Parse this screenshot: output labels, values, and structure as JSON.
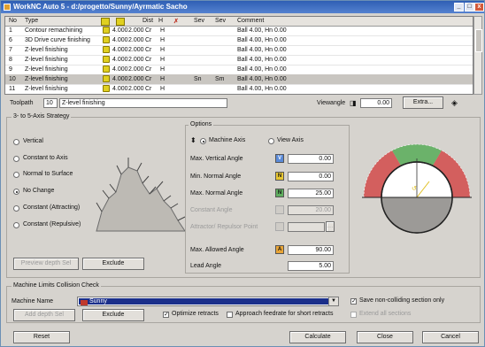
{
  "window": {
    "title": "WorkNC Auto 5 - d:/progetto/Sunny/Ayrmatic Sacho",
    "minimize": "_",
    "maximize": "□",
    "close": "x"
  },
  "toolpath_grid": {
    "headers": [
      "No",
      "Type",
      "",
      "",
      "Dist",
      "H",
      "",
      "Sev",
      "Sev",
      "Comment"
    ],
    "rows": [
      {
        "no": "1",
        "type": "Contour remachining",
        "v1": "4.000",
        "v2": "2.000",
        "v3": "Cr",
        "v4": "H",
        "s1": "",
        "s2": "",
        "comment": "Ball 4.00, Hn 0.00"
      },
      {
        "no": "6",
        "type": "3D Drive curve finishing",
        "v1": "4.000",
        "v2": "2.000",
        "v3": "Cr",
        "v4": "H",
        "s1": "",
        "s2": "",
        "comment": "Ball 4.00, Hn 0.00"
      },
      {
        "no": "7",
        "type": "Z-level finishing",
        "v1": "4.000",
        "v2": "2.000",
        "v3": "Cr",
        "v4": "H",
        "s1": "",
        "s2": "",
        "comment": "Ball 4.00, Hn 0.00"
      },
      {
        "no": "8",
        "type": "Z-level finishing",
        "v1": "4.000",
        "v2": "2.000",
        "v3": "Cr",
        "v4": "H",
        "s1": "",
        "s2": "",
        "comment": "Ball 4.00, Hn 0.00"
      },
      {
        "no": "9",
        "type": "Z-level finishing",
        "v1": "4.000",
        "v2": "2.000",
        "v3": "Cr",
        "v4": "H",
        "s1": "",
        "s2": "",
        "comment": "Ball 4.00, Hn 0.00"
      },
      {
        "no": "10",
        "type": "Z-level finishing",
        "v1": "4.000",
        "v2": "2.000",
        "v3": "Cr",
        "v4": "H",
        "s1": "Sn",
        "s2": "Sm",
        "comment": "Ball 4.00, Hn 0.00"
      },
      {
        "no": "11",
        "type": "Z-level finishing",
        "v1": "4.000",
        "v2": "2.000",
        "v3": "Cr",
        "v4": "H",
        "s1": "",
        "s2": "",
        "comment": "Ball 4.00, Hn 0.00"
      }
    ]
  },
  "toolpath_bar": {
    "label": "Toolpath",
    "number": "10",
    "name": "Z-level finishing",
    "viewangle_label": "Viewangle",
    "viewangle_value": "0.00",
    "extra_button": "Extra..."
  },
  "strategy": {
    "title": "3- to 5-Axis Strategy",
    "options": [
      "Vertical",
      "Constant to Axis",
      "Normal to Surface",
      "No Change",
      "Constant (Attracting)",
      "Constant (Repulsive)"
    ],
    "selected_index": 3,
    "preview_button": "Preview depth Sel",
    "exclude_button": "Exclude"
  },
  "options": {
    "title": "Options",
    "machine_axis_label": "Machine Axis",
    "view_axis_label": "View Axis",
    "fields": [
      {
        "label": "Max. Vertical Angle",
        "badge": "V",
        "value": "0.00"
      },
      {
        "label": "Min. Normal Angle",
        "badge": "N",
        "value": "0.00"
      },
      {
        "label": "Max. Normal Angle",
        "badge": "N",
        "value": "25.00"
      },
      {
        "label": "Constant Angle",
        "badge": "",
        "value": "20.00"
      },
      {
        "label": "Attractor/ Repulsor Point",
        "badge": "",
        "value": ""
      },
      {
        "label": "Max. Allowed Angle",
        "badge": "A",
        "value": "90.00"
      },
      {
        "label": "Lead Angle",
        "badge": "",
        "value": "5.00"
      }
    ]
  },
  "collision": {
    "title": "Machine Limits Collision Check",
    "machine_label": "Machine Name",
    "machine_value": "Sunny",
    "apply_button": "Add depth Sel",
    "exclude_button": "Exclude",
    "optimize_label": "Optimize retracts",
    "approach_label": "Approach feedrate for short retracts",
    "save_label": "Save non-colliding section only",
    "extend_label": "Extend all sections"
  },
  "footer": {
    "reset": "Reset",
    "calculate": "Calculate",
    "close": "Close",
    "cancel": "Cancel"
  },
  "colors": {
    "accent": "#2f5fb4",
    "gauge_red": "#d24a4a",
    "gauge_green": "#5fae5f"
  }
}
